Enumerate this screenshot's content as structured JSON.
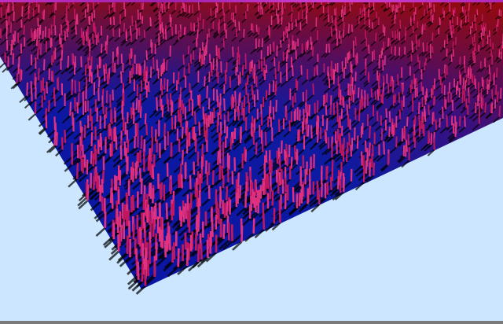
{
  "scene": {
    "sky_color": "#cde6ff",
    "ground_color_near": "#0a14a8",
    "ground_color_far": "#8a0a10",
    "plant_color": "#c01860",
    "plant_highlight": "#e03080",
    "shadow_color": "#000000",
    "strip_color": "#c030c0",
    "status_bar_color": "#7a7a7a"
  }
}
